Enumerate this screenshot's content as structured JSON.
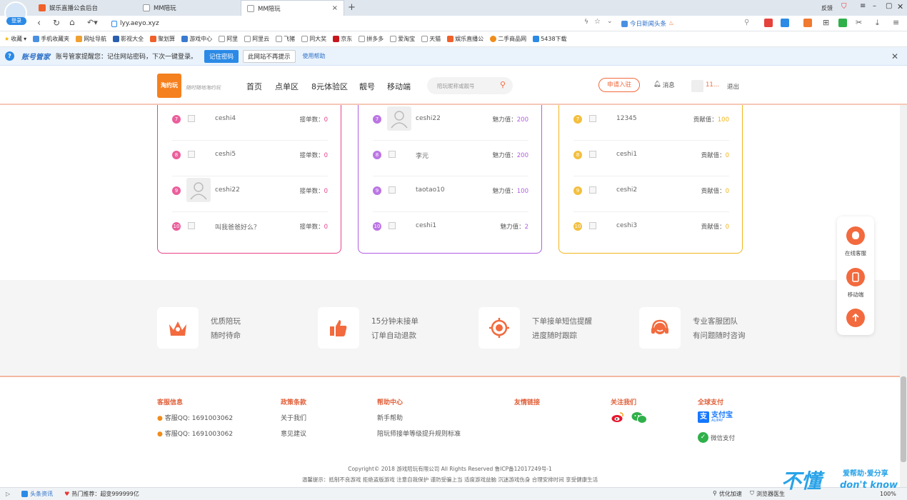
{
  "browser": {
    "login_badge": "登录",
    "tabs": [
      {
        "title": "娱乐直播公会后台",
        "color": "#f0602a"
      },
      {
        "title": "MM陪玩",
        "color": "#ffffff"
      },
      {
        "title": "MM陪玩",
        "color": "#ffffff"
      }
    ],
    "window_controls": {
      "feedback": "反馈"
    },
    "address": "lyy.aeyo.xyz",
    "news_label": "今日新闻头条",
    "bookmarks": [
      "收藏",
      "手机收藏夹",
      "网址导航",
      "影视大全",
      "聚划算",
      "游戏中心",
      "阿里",
      "阿里云",
      "飞猪",
      "同大奖",
      "京东",
      "拼多多",
      "爱淘宝",
      "天猫",
      "娱乐直播公",
      "二手商品网",
      "5438下载"
    ],
    "notice": {
      "brand": "账号管家",
      "text": "账号管家提醒您：记住网站密码，下次一键登录。",
      "btn_remember": "记住密码",
      "btn_never": "此网站不再提示",
      "help": "使用帮助"
    },
    "status": {
      "left1": "头条资讯",
      "left2": "热门推荐：超变999999亿",
      "right1": "优化加速",
      "right2": "浏览器医生",
      "zoom": "100%"
    }
  },
  "site": {
    "logo_text": "淘约玩",
    "logo_slogan": "随时随地淘约玩",
    "nav": [
      "首页",
      "点单区",
      "8元体验区",
      "靓号",
      "移动端"
    ],
    "search_placeholder": "陪玩昵称或靓号",
    "apply_button": "申请入驻",
    "messages": "消息",
    "username": "11...",
    "logout": "退出"
  },
  "rankings": [
    {
      "color": "#e8428a",
      "rows": [
        {
          "rank": "7",
          "name": "ceshi4",
          "label": "接单数：",
          "value": "0",
          "avatar": false
        },
        {
          "rank": "8",
          "name": "ceshi5",
          "label": "接单数：",
          "value": "0",
          "avatar": false
        },
        {
          "rank": "9",
          "name": "ceshi22",
          "label": "接单数：",
          "value": "0",
          "avatar": true
        },
        {
          "rank": "10",
          "name": "叫我爸爸好么？",
          "label": "接单数：",
          "value": "0",
          "avatar": false
        }
      ]
    },
    {
      "color": "#b05ee0",
      "rows": [
        {
          "rank": "7",
          "name": "ceshi22",
          "label": "魅力值：",
          "value": "200",
          "avatar": true
        },
        {
          "rank": "8",
          "name": "李元",
          "label": "魅力值：",
          "value": "200",
          "avatar": false
        },
        {
          "rank": "9",
          "name": "taotao10",
          "label": "魅力值：",
          "value": "100",
          "avatar": false
        },
        {
          "rank": "10",
          "name": "ceshi1",
          "label": "魅力值：",
          "value": "2",
          "avatar": false
        }
      ]
    },
    {
      "color": "#f2b51c",
      "rows": [
        {
          "rank": "7",
          "name": "12345",
          "label": "贡献值：",
          "value": "100",
          "avatar": false
        },
        {
          "rank": "8",
          "name": "ceshi1",
          "label": "贡献值：",
          "value": "0",
          "avatar": false
        },
        {
          "rank": "9",
          "name": "ceshi2",
          "label": "贡献值：",
          "value": "0",
          "avatar": false
        },
        {
          "rank": "10",
          "name": "ceshi3",
          "label": "贡献值：",
          "value": "0",
          "avatar": false
        }
      ]
    }
  ],
  "features": [
    {
      "line1": "优质陪玩",
      "line2": "随时待命",
      "icon": "crown-icon"
    },
    {
      "line1": "15分钟未接单",
      "line2": "订单自动退款",
      "icon": "thumbs-up-icon"
    },
    {
      "line1": "下单接单短信提醒",
      "line2": "进度随时跟踪",
      "icon": "target-icon"
    },
    {
      "line1": "专业客服团队",
      "line2": "有问题随时咨询",
      "icon": "headset-icon"
    }
  ],
  "footer": {
    "service_title": "客服信息",
    "service_lines": [
      "客服QQ: 1691003062",
      "客服QQ: 1691003062"
    ],
    "policy_title": "政策条款",
    "policy_links": [
      "关于我们",
      "意见建议"
    ],
    "help_title": "帮助中心",
    "help_links": [
      "新手帮助",
      "陪玩师接单等级提升规则标准"
    ],
    "friends_title": "友情链接",
    "follow_title": "关注我们",
    "pay_title": "全球支付",
    "alipay": "支付宝",
    "alipay_en": "ALIPAY",
    "wechat_pay": "微信支付",
    "copyright": "Copyright© 2018 游戏陪玩有限公司 All Rights Reserved 鲁ICP备12017249号-1",
    "tips": "温馨提示：抵制不良游戏 拒绝盗版游戏 注意自我保护 谨防受骗上当 适度游戏益脑 沉迷游戏伤身 合理安排时间 享受健康生活"
  },
  "float_bar": {
    "online_service": "在线客服",
    "mobile": "移动端"
  },
  "watermark": {
    "cn": "不懂",
    "sub": "爱帮助·爱分享",
    "en": "don't know"
  }
}
